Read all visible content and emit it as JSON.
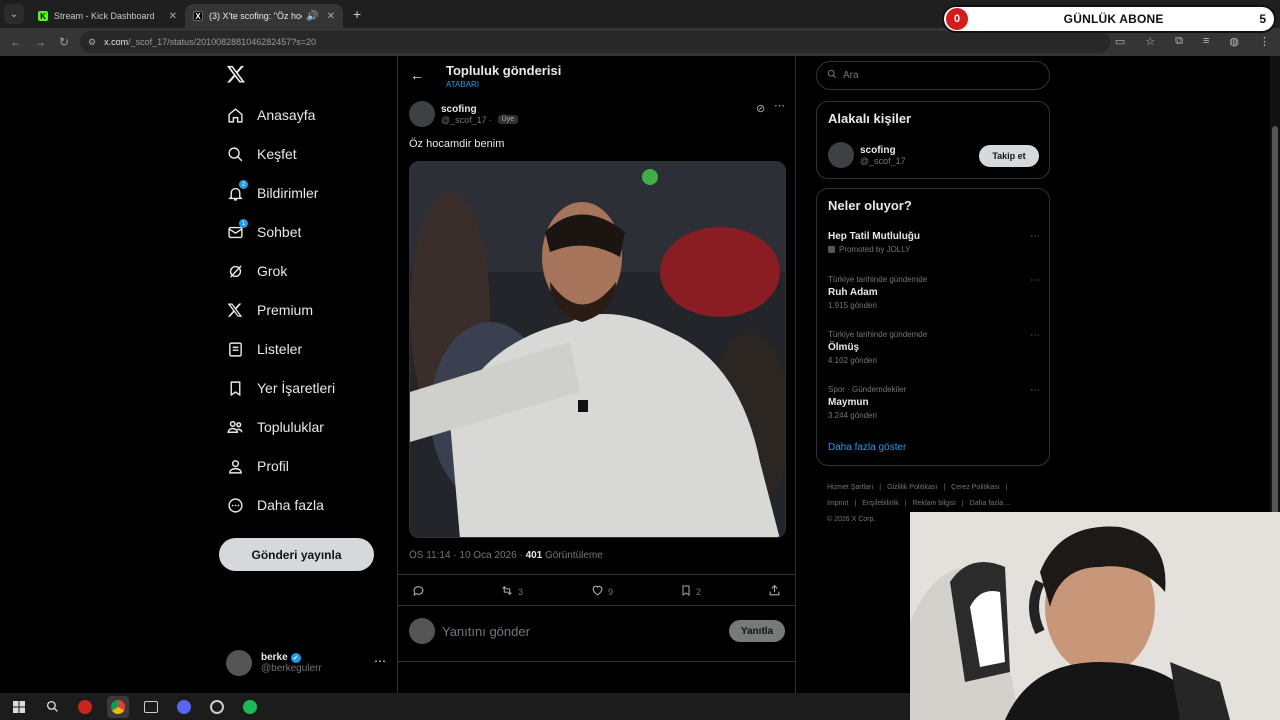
{
  "browser": {
    "tabs": [
      {
        "title": "Stream - Kick Dashboard",
        "favicon": "K"
      },
      {
        "title": "(3) X'te scofing: \"Öz hocam",
        "favicon": "X"
      }
    ],
    "url_host": "x.com",
    "url_path": "/_scof_17/status/2010082881046282457?s=20"
  },
  "overlay": {
    "sub_count": "0",
    "sub_label": "GÜNLÜK ABONE",
    "sub_goal": "5"
  },
  "nav": {
    "items": [
      {
        "label": "Anasayfa",
        "icon": "home-icon"
      },
      {
        "label": "Keşfet",
        "icon": "search-icon"
      },
      {
        "label": "Bildirimler",
        "icon": "bell-icon",
        "badge": "2"
      },
      {
        "label": "Sohbet",
        "icon": "mail-icon",
        "badge": "1"
      },
      {
        "label": "Grok",
        "icon": "grok-icon"
      },
      {
        "label": "Premium",
        "icon": "x-icon"
      },
      {
        "label": "Listeler",
        "icon": "list-icon"
      },
      {
        "label": "Yer İşaretleri",
        "icon": "bookmark-icon"
      },
      {
        "label": "Topluluklar",
        "icon": "communities-icon"
      },
      {
        "label": "Profil",
        "icon": "profile-icon"
      },
      {
        "label": "Daha fazla",
        "icon": "more-circle-icon"
      }
    ],
    "post_button": "Gönderi yayınla",
    "account": {
      "name": "berke",
      "handle": "@berkegulerr"
    }
  },
  "main": {
    "header_title": "Topluluk gönderisi",
    "header_sub": "ATABARI",
    "author": {
      "name": "scofing",
      "handle": "@_scof_17",
      "tag": "Üye"
    },
    "tweet_text": "Öz hocamdir benim",
    "timestamp": "ÖS 11:14 · 10 Oca 2026 · ",
    "views_num": "401",
    "views_label": " Görüntüleme",
    "stats": {
      "replies": "",
      "retweets": "3",
      "likes": "9",
      "bookmarks": "2"
    },
    "reply_placeholder": "Yanıtını gönder",
    "reply_button": "Yanıtla"
  },
  "right": {
    "search_placeholder": "Ara",
    "relevant_title": "Alakalı kişiler",
    "relevant_user": {
      "name": "scofing",
      "handle": "@_scof_17"
    },
    "follow_button": "Takip et",
    "trends_title": "Neler oluyor?",
    "trends": [
      {
        "context": "",
        "name": "Hep Tatil Mutluluğu",
        "promoted": "Promoted by JOLLY",
        "count": ""
      },
      {
        "context": "Türkiye tarihinde gündemde",
        "name": "Ruh Adam",
        "count": "1.915 gönderi"
      },
      {
        "context": "Türkiye tarihinde gündemde",
        "name": "Ölmüş",
        "count": "4.102 gönderi"
      },
      {
        "context": "Spor · Gündemdekiler",
        "name": "Maymun",
        "count": "3.244 gönderi"
      }
    ],
    "show_more": "Daha fazla göster",
    "footer": [
      "Hizmet Şartları",
      "|",
      "Gizlilik Politikası",
      "|",
      "Çerez Politikası",
      "|",
      "Imprint",
      "|",
      "Erişilebilirlik",
      "|",
      "Reklam bilgisi",
      "|",
      "Daha fazla ...",
      "© 2026 X Corp."
    ]
  }
}
